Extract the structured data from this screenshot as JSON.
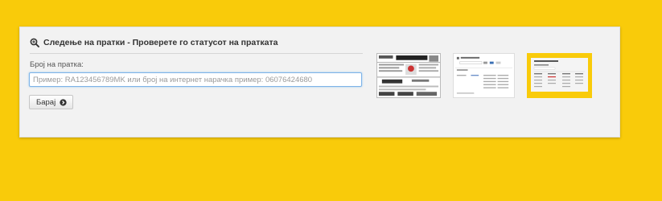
{
  "header": {
    "title": "Следење на пратки - Проверете го статусот на пратката",
    "icon": "zoom-in-icon"
  },
  "form": {
    "field_label": "Број на пратка:",
    "input_value": "",
    "input_placeholder": "Пример: RA123456789MK или број на интернет нарачка пример: 06076424680",
    "button_label": "Барај",
    "button_icon": "circle-chevron-right-icon"
  },
  "thumbnails": [
    {
      "name": "label-sample-thumbnail"
    },
    {
      "name": "tracking-result-thumbnail"
    },
    {
      "name": "tracking-table-thumbnail"
    }
  ],
  "colors": {
    "page_background": "#f9cb0a",
    "panel_background": "#f2f2f2",
    "input_focus_border": "#7db3e8",
    "text": "#333333"
  }
}
